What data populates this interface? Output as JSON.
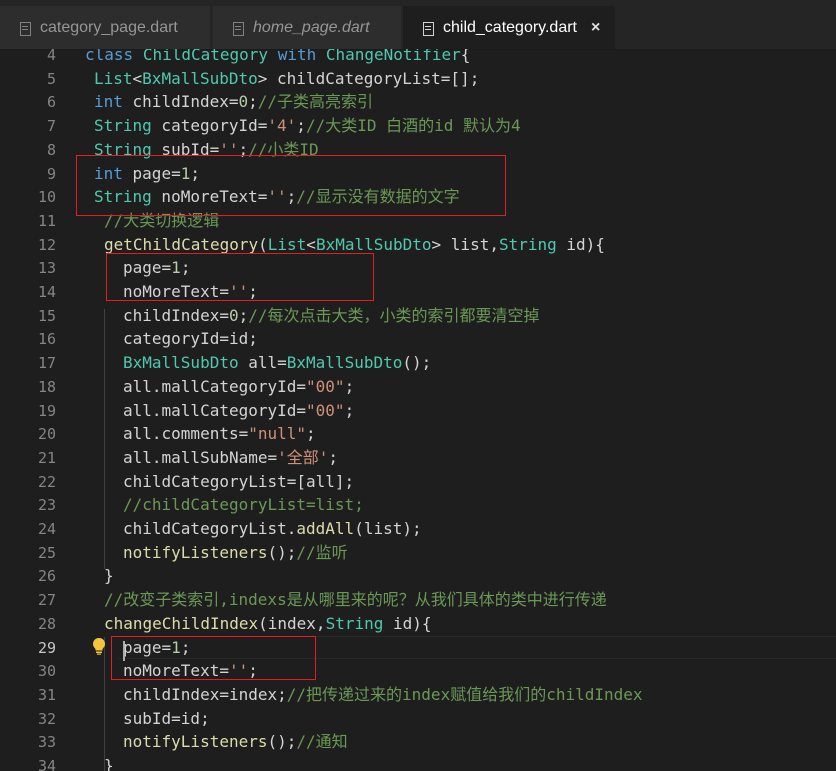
{
  "tabs": [
    {
      "label": "category_page.dart",
      "active": false,
      "italic": false
    },
    {
      "label": "home_page.dart",
      "active": false,
      "italic": true
    },
    {
      "label": "child_category.dart",
      "active": true,
      "italic": false,
      "close": "×"
    }
  ],
  "editor": {
    "current_line": 29,
    "line_numbers": [
      "4",
      "5",
      "6",
      "7",
      "8",
      "9",
      "10",
      "11",
      "12",
      "13",
      "14",
      "15",
      "16",
      "17",
      "18",
      "19",
      "20",
      "21",
      "22",
      "23",
      "24",
      "25",
      "26",
      "27",
      "28",
      "29",
      "30",
      "31",
      "32",
      "33",
      "34"
    ],
    "lines": [
      {
        "n": 4,
        "tokens": [
          [
            "kw",
            "class"
          ],
          [
            "tx",
            " "
          ],
          [
            "ty",
            "ChildCategory"
          ],
          [
            "tx",
            " "
          ],
          [
            "kw",
            "with"
          ],
          [
            "tx",
            " "
          ],
          [
            "ty",
            "ChangeNotifier"
          ],
          [
            "tx",
            "{"
          ]
        ]
      },
      {
        "n": 5,
        "tokens": [
          [
            "ty",
            "List"
          ],
          [
            "tx",
            "<"
          ],
          [
            "ty",
            "BxMallSubDto"
          ],
          [
            "tx",
            "> childCategoryList=[];"
          ]
        ]
      },
      {
        "n": 6,
        "tokens": [
          [
            "kw",
            "int"
          ],
          [
            "tx",
            " childIndex="
          ],
          [
            "nm",
            "0"
          ],
          [
            "tx",
            ";"
          ],
          [
            "cm",
            "//子类高亮索引"
          ]
        ]
      },
      {
        "n": 7,
        "tokens": [
          [
            "ty",
            "String"
          ],
          [
            "tx",
            " categoryId="
          ],
          [
            "st",
            "'4'"
          ],
          [
            "tx",
            ";"
          ],
          [
            "cm",
            "//大类ID 白酒的id 默认为4"
          ]
        ]
      },
      {
        "n": 8,
        "tokens": [
          [
            "ty",
            "String"
          ],
          [
            "tx",
            " subId="
          ],
          [
            "st",
            "''"
          ],
          [
            "tx",
            ";"
          ],
          [
            "cm",
            "//小类ID"
          ]
        ]
      },
      {
        "n": 9,
        "tokens": [
          [
            "kw",
            "int"
          ],
          [
            "tx",
            " page="
          ],
          [
            "nm",
            "1"
          ],
          [
            "tx",
            ";"
          ]
        ]
      },
      {
        "n": 10,
        "tokens": [
          [
            "ty",
            "String"
          ],
          [
            "tx",
            " noMoreText="
          ],
          [
            "st",
            "''"
          ],
          [
            "tx",
            ";"
          ],
          [
            "cm",
            "//显示没有数据的文字"
          ]
        ]
      },
      {
        "n": 11,
        "tokens": [
          [
            "cm",
            "//大类切换逻辑"
          ]
        ]
      },
      {
        "n": 12,
        "tokens": [
          [
            "fn",
            "getChildCategory"
          ],
          [
            "tx",
            "("
          ],
          [
            "ty",
            "List"
          ],
          [
            "tx",
            "<"
          ],
          [
            "ty",
            "BxMallSubDto"
          ],
          [
            "tx",
            "> list,"
          ],
          [
            "ty",
            "String"
          ],
          [
            "tx",
            " id){"
          ]
        ]
      },
      {
        "n": 13,
        "tokens": [
          [
            "tx",
            "page="
          ],
          [
            "nm",
            "1"
          ],
          [
            "tx",
            ";"
          ]
        ]
      },
      {
        "n": 14,
        "tokens": [
          [
            "tx",
            "noMoreText="
          ],
          [
            "st",
            "''"
          ],
          [
            "tx",
            ";"
          ]
        ]
      },
      {
        "n": 15,
        "tokens": [
          [
            "tx",
            "childIndex="
          ],
          [
            "nm",
            "0"
          ],
          [
            "tx",
            ";"
          ],
          [
            "cm",
            "//每次点击大类，小类的索引都要清空掉"
          ]
        ]
      },
      {
        "n": 16,
        "tokens": [
          [
            "tx",
            "categoryId=id;"
          ]
        ]
      },
      {
        "n": 17,
        "tokens": [
          [
            "ty",
            "BxMallSubDto"
          ],
          [
            "tx",
            " all="
          ],
          [
            "ty",
            "BxMallSubDto"
          ],
          [
            "tx",
            "();"
          ]
        ]
      },
      {
        "n": 18,
        "tokens": [
          [
            "tx",
            "all.mallCategoryId="
          ],
          [
            "st",
            "\"00\""
          ],
          [
            "tx",
            ";"
          ]
        ]
      },
      {
        "n": 19,
        "tokens": [
          [
            "tx",
            "all.mallCategoryId="
          ],
          [
            "st",
            "\"00\""
          ],
          [
            "tx",
            ";"
          ]
        ]
      },
      {
        "n": 20,
        "tokens": [
          [
            "tx",
            "all.comments="
          ],
          [
            "st",
            "\"null\""
          ],
          [
            "tx",
            ";"
          ]
        ]
      },
      {
        "n": 21,
        "tokens": [
          [
            "tx",
            "all.mallSubName="
          ],
          [
            "st",
            "'全部'"
          ],
          [
            "tx",
            ";"
          ]
        ]
      },
      {
        "n": 22,
        "tokens": [
          [
            "tx",
            "childCategoryList=[all];"
          ]
        ]
      },
      {
        "n": 23,
        "tokens": [
          [
            "cm",
            "//childCategoryList=list;"
          ]
        ]
      },
      {
        "n": 24,
        "tokens": [
          [
            "tx",
            "childCategoryList."
          ],
          [
            "fn",
            "addAll"
          ],
          [
            "tx",
            "(list);"
          ]
        ]
      },
      {
        "n": 25,
        "tokens": [
          [
            "fn",
            "notifyListeners"
          ],
          [
            "tx",
            "();"
          ],
          [
            "cm",
            "//监听"
          ]
        ]
      },
      {
        "n": 26,
        "tokens": [
          [
            "tx",
            "}"
          ]
        ]
      },
      {
        "n": 27,
        "tokens": [
          [
            "cm",
            "//改变子类索引,indexs是从哪里来的呢？从我们具体的类中进行传递"
          ]
        ]
      },
      {
        "n": 28,
        "tokens": [
          [
            "fn",
            "changeChildIndex"
          ],
          [
            "tx",
            "(index,"
          ],
          [
            "ty",
            "String"
          ],
          [
            "tx",
            " id){"
          ]
        ]
      },
      {
        "n": 29,
        "tokens": [
          [
            "tx",
            "page="
          ],
          [
            "nm",
            "1"
          ],
          [
            "tx",
            ";"
          ]
        ]
      },
      {
        "n": 30,
        "tokens": [
          [
            "tx",
            "noMoreText="
          ],
          [
            "st",
            "''"
          ],
          [
            "tx",
            ";"
          ]
        ]
      },
      {
        "n": 31,
        "tokens": [
          [
            "tx",
            "childIndex=index;"
          ],
          [
            "cm",
            "//把传递过来的index赋值给我们的childIndex"
          ]
        ]
      },
      {
        "n": 32,
        "tokens": [
          [
            "tx",
            "subId=id;"
          ]
        ]
      },
      {
        "n": 33,
        "tokens": [
          [
            "fn",
            "notifyListeners"
          ],
          [
            "tx",
            "();"
          ],
          [
            "cm",
            "//通知"
          ]
        ]
      },
      {
        "n": 34,
        "tokens": [
          [
            "tx",
            "}"
          ]
        ]
      }
    ]
  },
  "icons": {
    "file_icon": "file-lines-icon",
    "lightbulb": "lightbulb-icon"
  },
  "colors": {
    "highlight_box": "#e02020",
    "background": "#1e1e1e"
  }
}
